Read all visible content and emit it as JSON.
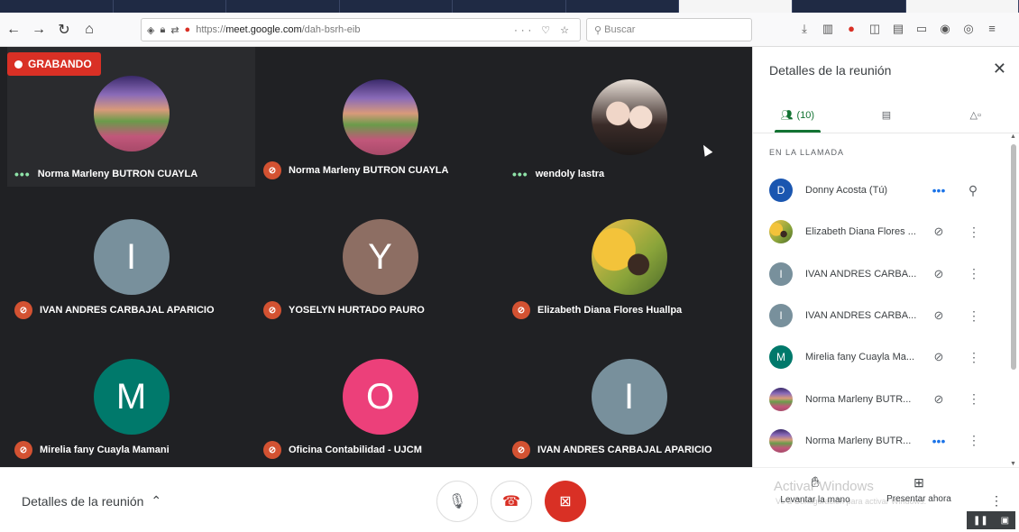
{
  "browser": {
    "url_prefix": "https://",
    "url_domain": "meet.google.com",
    "url_path": "/dah-bsrh-eib",
    "search_placeholder": "Buscar"
  },
  "recording": {
    "label": "GRABANDO"
  },
  "tiles": [
    {
      "name": "Norma Marleny BUTRON CUAYLA",
      "status": "speaking",
      "avatar": "landscape-photo"
    },
    {
      "name": "Norma Marleny BUTRON CUAYLA",
      "status": "muted",
      "avatar": "landscape-photo"
    },
    {
      "name": "wendoly lastra",
      "status": "speaking",
      "avatar": "couple-photo"
    },
    {
      "name": "IVAN ANDRES CARBAJAL APARICIO",
      "status": "muted",
      "initial": "I",
      "color": "#78909c"
    },
    {
      "name": "YOSELYN HURTADO PAURO",
      "status": "muted",
      "initial": "Y",
      "color": "#8d6e63"
    },
    {
      "name": "Elizabeth Diana Flores Huallpa",
      "status": "muted",
      "avatar": "sunflower-photo"
    },
    {
      "name": "Mirelia fany Cuayla Mamani",
      "status": "muted",
      "initial": "M",
      "color": "#00796b"
    },
    {
      "name": "Oficina Contabilidad - UJCM",
      "status": "muted",
      "initial": "O",
      "color": "#ec407a"
    },
    {
      "name": "IVAN ANDRES CARBAJAL APARICIO",
      "status": "muted",
      "initial": "I",
      "color": "#78909c"
    }
  ],
  "panel": {
    "title": "Detalles de la reunión",
    "people_count": "(10)",
    "section_label": "EN LA LLAMADA",
    "participants": [
      {
        "name": "Donny Acosta (Tú)",
        "initial": "D",
        "color": "#1a56b0",
        "action": "speaking"
      },
      {
        "name": "Elizabeth Diana Flores ...",
        "avatar": "sunflower-photo",
        "action": "muted"
      },
      {
        "name": "IVAN ANDRES CARBA...",
        "initial": "I",
        "color": "#78909c",
        "action": "muted"
      },
      {
        "name": "IVAN ANDRES CARBA...",
        "initial": "I",
        "color": "#78909c",
        "action": "muted"
      },
      {
        "name": "Mirelia fany Cuayla Ma...",
        "initial": "M",
        "color": "#00796b",
        "action": "muted"
      },
      {
        "name": "Norma Marleny BUTR...",
        "avatar": "landscape-photo",
        "action": "muted"
      },
      {
        "name": "Norma Marleny BUTR...",
        "avatar": "landscape-photo",
        "action": "speaking"
      }
    ]
  },
  "bottom": {
    "details_label": "Detalles de la reunión",
    "raise_hand": "Levantar la mano",
    "present_now": "Presentar ahora",
    "watermark_title": "Activar Windows",
    "watermark_sub": "Ve a Configuración para activar Windows."
  },
  "colors": {
    "accent_green": "#137333",
    "danger_red": "#d93025",
    "stage_bg": "#202124"
  }
}
